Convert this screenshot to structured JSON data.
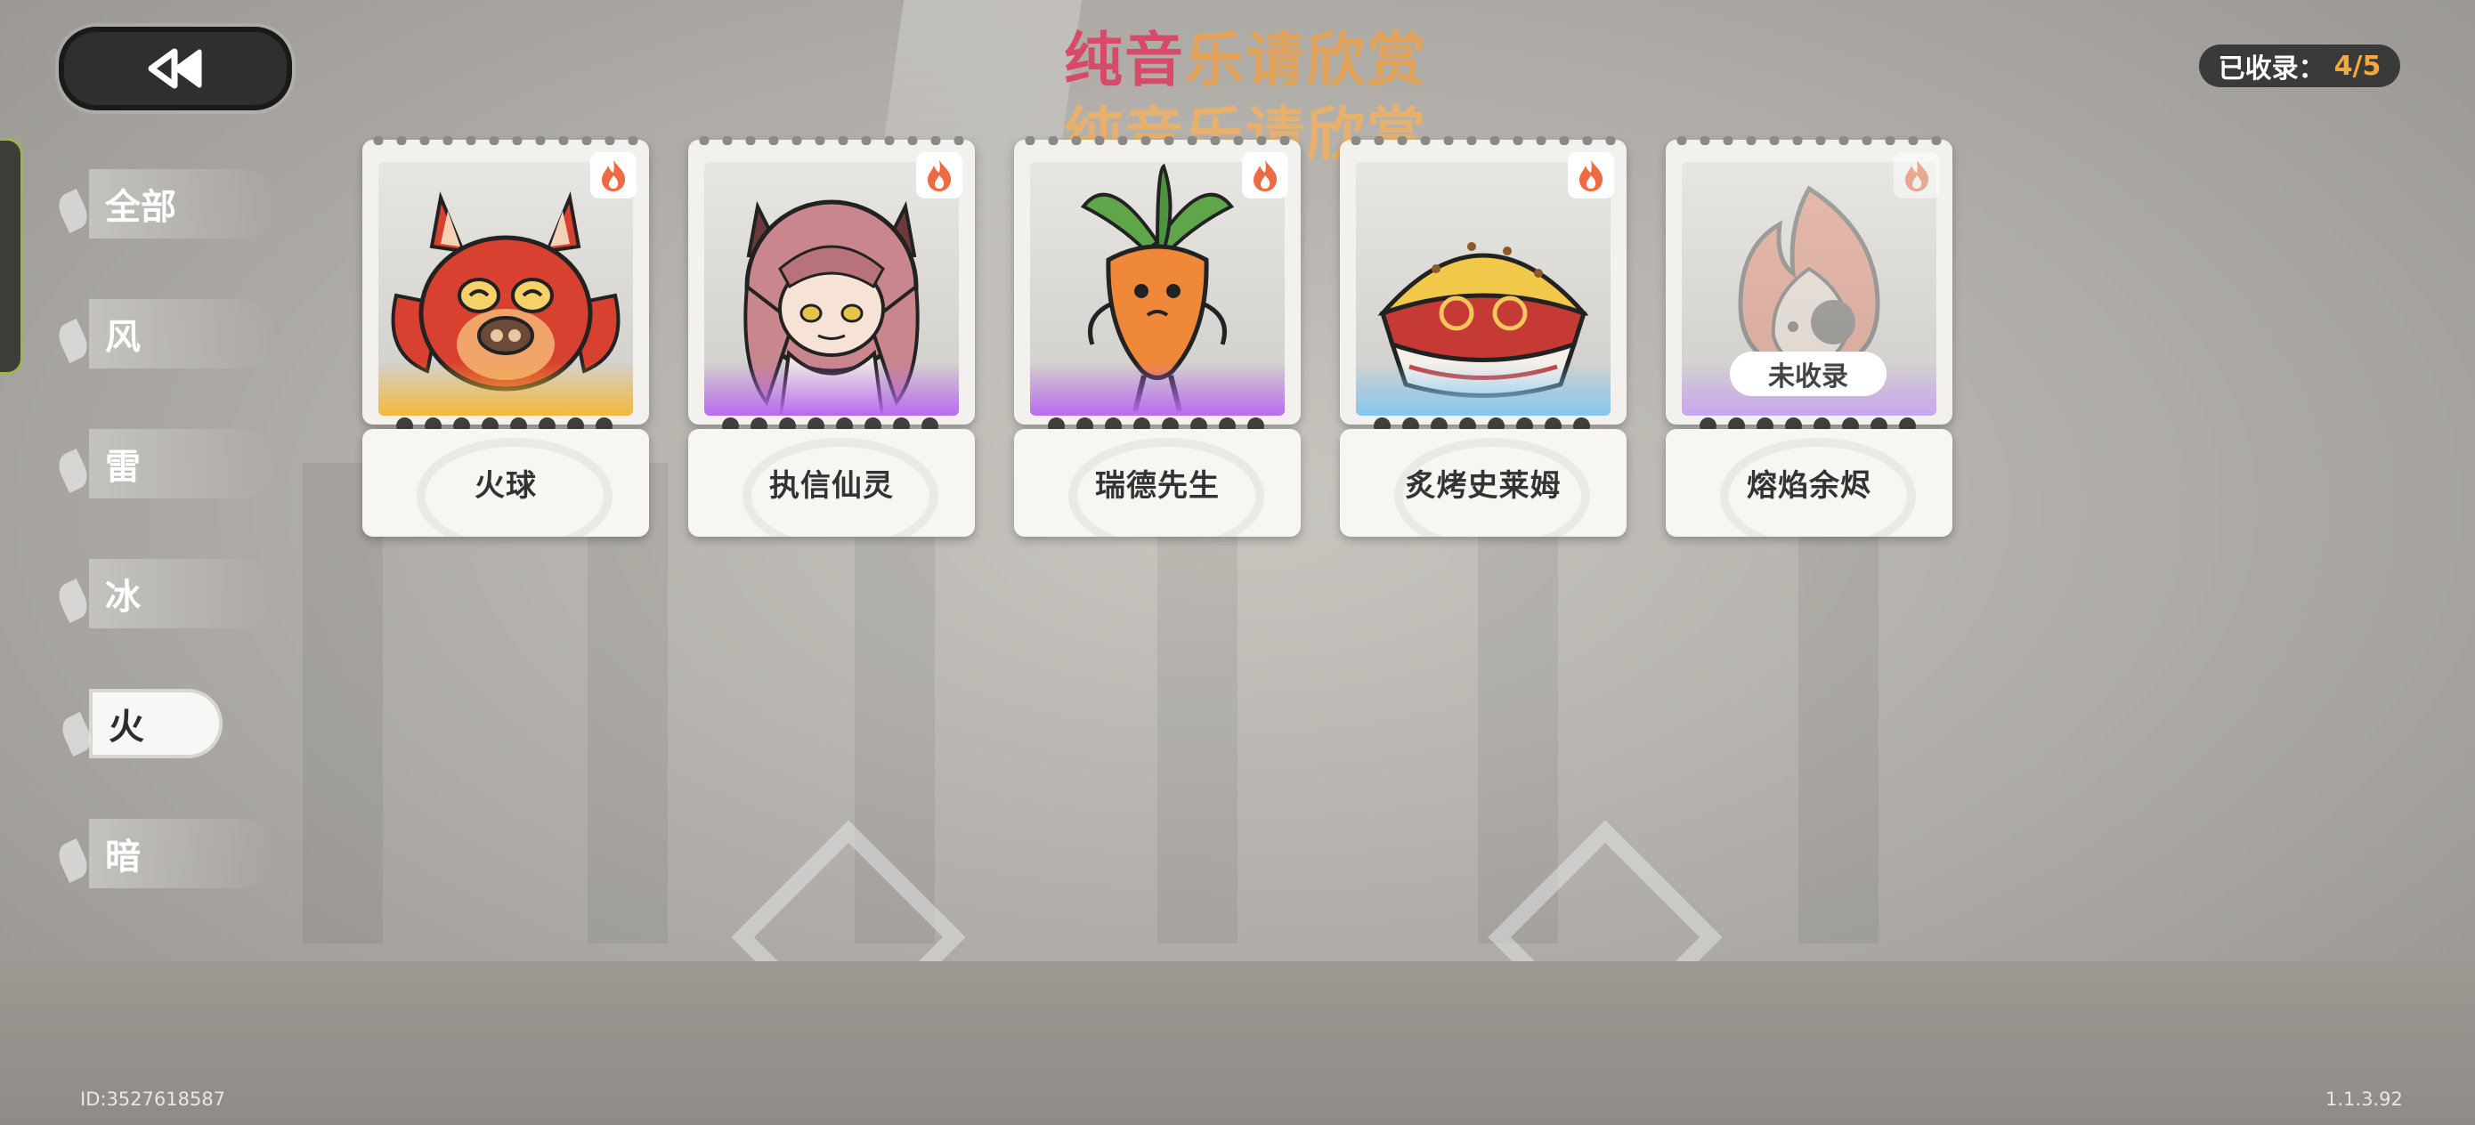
{
  "header": {
    "title_line1_a": "纯音",
    "title_line1_b": "乐请欣赏",
    "title_line2": "纯音乐请欣赏",
    "collected_label": "已收录：",
    "collected_count": "4/5"
  },
  "back_button": {
    "icon": "rewind-double-chevron-icon"
  },
  "categories": [
    {
      "label": "全部",
      "active": false
    },
    {
      "label": "风",
      "active": false
    },
    {
      "label": "雷",
      "active": false
    },
    {
      "label": "冰",
      "active": false
    },
    {
      "label": "火",
      "active": true
    },
    {
      "label": "暗",
      "active": false
    }
  ],
  "cards": [
    {
      "name": "火球",
      "collected": true,
      "rarity_color": "#f3b93b",
      "element_icon": "fire-icon",
      "art": "red-owl-creature"
    },
    {
      "name": "执信仙灵",
      "collected": true,
      "rarity_color": "#b86cf0",
      "element_icon": "fire-icon",
      "art": "pink-haired-fox-girl"
    },
    {
      "name": "瑞德先生",
      "collected": true,
      "rarity_color": "#b86cf0",
      "element_icon": "fire-icon",
      "art": "carrot-character"
    },
    {
      "name": "炙烤史莱姆",
      "collected": true,
      "rarity_color": "#86c7ef",
      "element_icon": "fire-icon",
      "art": "pie-slime"
    },
    {
      "name": "熔焰余烬",
      "collected": false,
      "rarity_color": "#c8a6ef",
      "element_icon": "fire-icon",
      "art": "ember-spirit",
      "locked_label": "未收录"
    }
  ],
  "footer": {
    "uid": "ID:3527618587",
    "version": "1.1.3.92"
  },
  "colors": {
    "accent_pink": "#d94a68",
    "accent_orange": "#e2a45a",
    "count_orange": "#f3a93c",
    "fire": "#ee6a43"
  }
}
